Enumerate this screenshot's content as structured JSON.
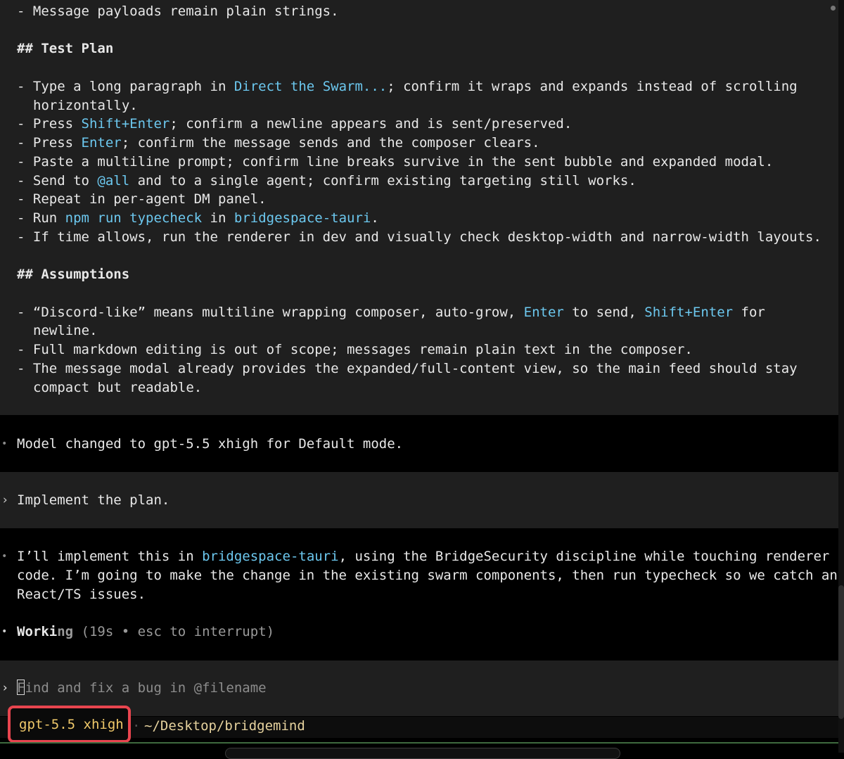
{
  "plan": {
    "line1": "- Message payloads remain plain strings.",
    "heading_test": "## Test Plan",
    "test1a": "- Type a long paragraph in ",
    "test1b": "Direct the Swarm...",
    "test1c": "; confirm it wraps and expands instead of scrolling",
    "test1d": "horizontally.",
    "test2a": "- Press ",
    "test2b": "Shift+Enter",
    "test2c": "; confirm a newline appears and is sent/preserved.",
    "test3a": "- Press ",
    "test3b": "Enter",
    "test3c": "; confirm the message sends and the composer clears.",
    "test4": "- Paste a multiline prompt; confirm line breaks survive in the sent bubble and expanded modal.",
    "test5a": "- Send to ",
    "test5b": "@all",
    "test5c": " and to a single agent; confirm existing targeting still works.",
    "test6": "- Repeat in per-agent DM panel.",
    "test7a": "- Run ",
    "test7b": "npm run typecheck",
    "test7c": " in ",
    "test7d": "bridgespace-tauri",
    "test7e": ".",
    "test8": "- If time allows, run the renderer in dev and visually check desktop-width and narrow-width layouts.",
    "heading_assumptions": "## Assumptions",
    "as1a": "- “Discord-like” means multiline wrapping composer, auto-grow, ",
    "as1b": "Enter",
    "as1c": " to send, ",
    "as1d": "Shift+Enter",
    "as1e": " for",
    "as1f": "newline.",
    "as2": "- Full markdown editing is out of scope; messages remain plain text in the composer.",
    "as3a": "- The message modal already provides the expanded/full-content view, so the main feed should stay",
    "as3b": "compact but readable."
  },
  "feed": {
    "bullet": "•",
    "model_changed": "Model changed to gpt-5.5 xhigh for Default mode.",
    "prompt_chevron": "›",
    "prompt_text": "Implement the plan.",
    "reply1a": "I’ll implement this in ",
    "reply1b": "bridgespace-tauri",
    "reply1c": ", using the BridgeSecurity discipline while touching renderer",
    "reply2": "code. I’m going to make the change in the existing swarm components, then run typecheck so we catch any",
    "reply3": "React/TS issues.",
    "working_bright": "Worki",
    "working_dim": "ng",
    "working_status": " (19s • esc to interrupt)"
  },
  "composer": {
    "chevron": "›",
    "placeholder_first": "F",
    "placeholder_rest": "ind and fix a bug in @filename"
  },
  "statusbar": {
    "model": "gpt-5.5 xhigh",
    "separator": "·",
    "path": "~/Desktop/bridgemind"
  }
}
